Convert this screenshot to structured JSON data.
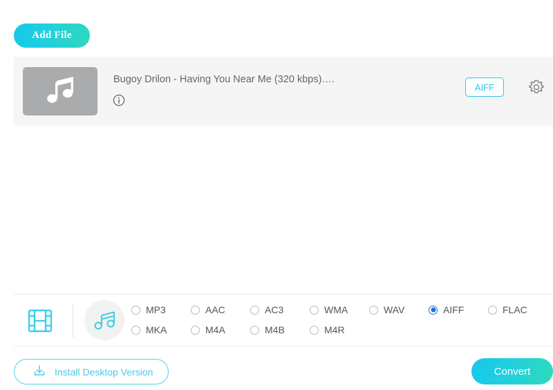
{
  "toolbar": {
    "add_file_label": "Add File"
  },
  "file_list": {
    "items": [
      {
        "name": "Bugoy Drilon - Having You Near Me (320 kbps)….",
        "format_badge": "AIFF",
        "thumb_icon": "music-note-icon",
        "info_icon": "info-icon",
        "settings_icon": "gear-icon"
      }
    ]
  },
  "format_bar": {
    "video_tab_icon": "film-strip-icon",
    "audio_tab_icon": "music-note-icon",
    "formats": [
      {
        "label": "MP3",
        "selected": false,
        "col": 0,
        "row": 0
      },
      {
        "label": "AAC",
        "selected": false,
        "col": 1,
        "row": 0
      },
      {
        "label": "AC3",
        "selected": false,
        "col": 2,
        "row": 0
      },
      {
        "label": "WMA",
        "selected": false,
        "col": 3,
        "row": 0
      },
      {
        "label": "WAV",
        "selected": false,
        "col": 4,
        "row": 0
      },
      {
        "label": "AIFF",
        "selected": true,
        "col": 5,
        "row": 0
      },
      {
        "label": "FLAC",
        "selected": false,
        "col": 6,
        "row": 0
      },
      {
        "label": "MKA",
        "selected": false,
        "col": 0,
        "row": 1
      },
      {
        "label": "M4A",
        "selected": false,
        "col": 1,
        "row": 1
      },
      {
        "label": "M4B",
        "selected": false,
        "col": 2,
        "row": 1
      },
      {
        "label": "M4R",
        "selected": false,
        "col": 3,
        "row": 1
      }
    ]
  },
  "bottom_bar": {
    "install_label": "Install Desktop Version",
    "install_icon": "download-icon",
    "convert_label": "Convert"
  },
  "colors": {
    "accent_cyan": "#2ec6e6",
    "gradient_start": "#17c8ea",
    "gradient_end": "#2ed9bb",
    "radio_selected": "#1a73d6",
    "panel_bg": "#f5f5f5"
  }
}
